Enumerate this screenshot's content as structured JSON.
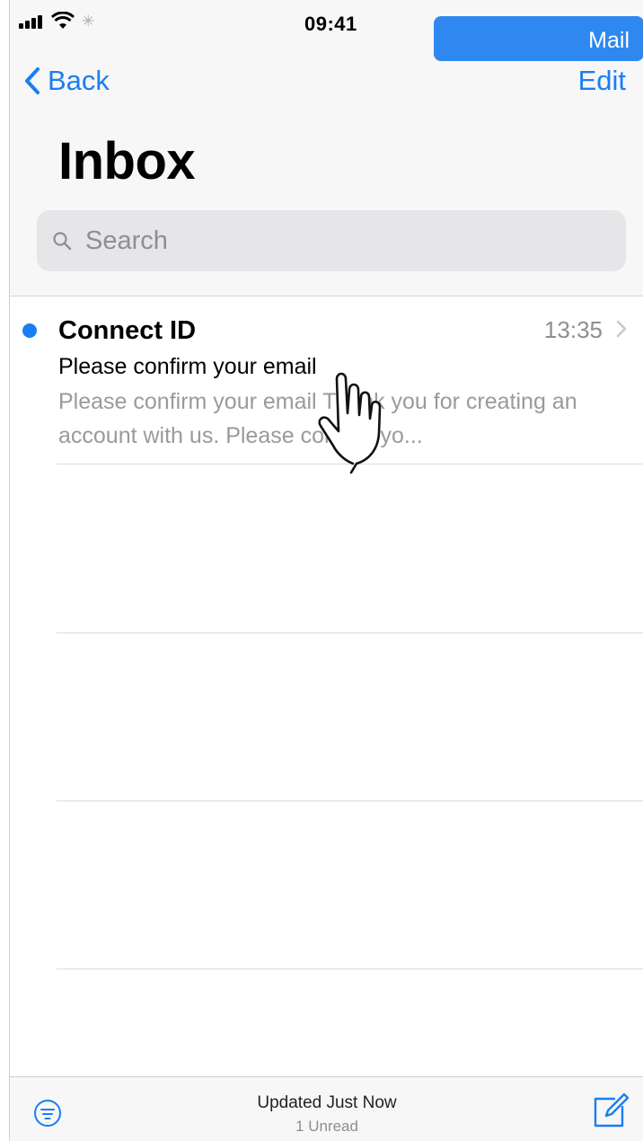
{
  "status_bar": {
    "time": "09:41",
    "return_app": "Mail"
  },
  "nav": {
    "back_label": "Back",
    "edit_label": "Edit"
  },
  "title": "Inbox",
  "search": {
    "placeholder": "Search",
    "icon": "search-icon"
  },
  "messages": [
    {
      "sender": "Connect ID",
      "time": "13:35",
      "subject": "Please confirm your email",
      "preview": "Please confirm your email Thank you for creating an account with us. Please confirm yo...",
      "unread": true
    }
  ],
  "toolbar": {
    "status": "Updated Just Now",
    "unread": "1 Unread",
    "filter_icon": "filter-icon",
    "compose_icon": "compose-icon"
  },
  "colors": {
    "accent": "#1a7ef2",
    "pill": "#2f88f0",
    "secondary_text": "#8e8e93"
  }
}
